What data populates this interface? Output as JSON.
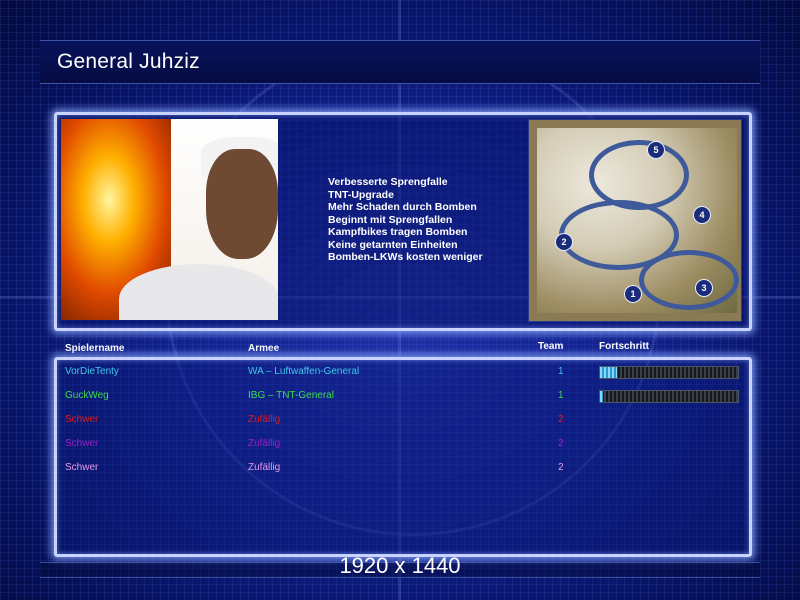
{
  "header": {
    "title": "General Juhziz"
  },
  "general_bonuses": [
    "Verbesserte Sprengfalle",
    "TNT-Upgrade",
    "Mehr Schaden durch Bomben",
    "Beginnt mit Sprengfallen",
    "Kampfbikes tragen Bomben",
    "Keine getarnten Einheiten",
    "Bomben-LKWs kosten weniger"
  ],
  "minimap": {
    "start_positions": [
      "1",
      "2",
      "3",
      "4",
      "5"
    ]
  },
  "table": {
    "columns": {
      "player": "Spielername",
      "army": "Armee",
      "team": "Team",
      "progress": "Fortschritt"
    },
    "rows": [
      {
        "player": "VorDieTenty",
        "army": "WA – Luftwaffen-General",
        "team": "1",
        "color": "#3ec8e8",
        "progress": 0.12
      },
      {
        "player": "GuckWeg",
        "army": "IBG – TNT-General",
        "team": "1",
        "color": "#3edc4a",
        "progress": 0.02
      },
      {
        "player": "Schwer",
        "army": "Zufällig",
        "team": "2",
        "color": "#e01818"
      },
      {
        "player": "Schwer",
        "army": "Zufällig",
        "team": "2",
        "color": "#9a1ec8"
      },
      {
        "player": "Schwer",
        "army": "Zufällig",
        "team": "2",
        "color": "#e89ae8"
      }
    ]
  },
  "footer": {
    "resolution": "1920 x 1440"
  }
}
